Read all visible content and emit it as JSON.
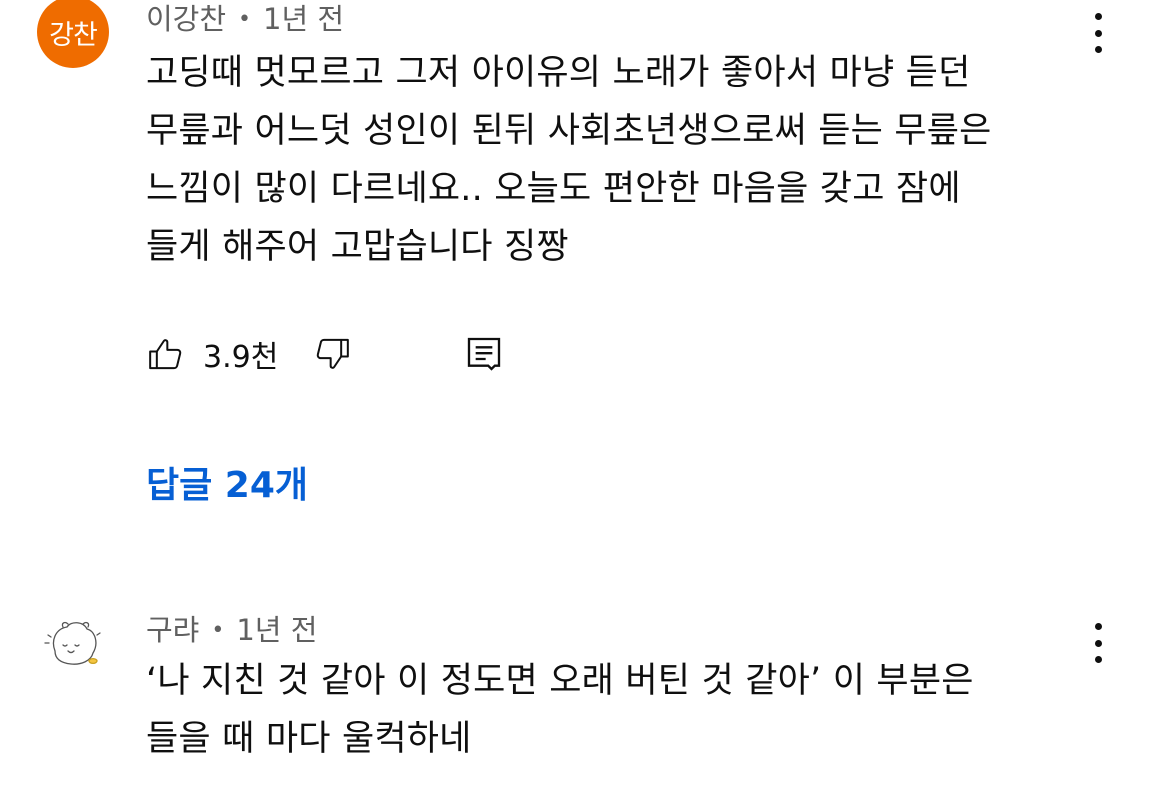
{
  "comments": [
    {
      "avatar_text": "강찬",
      "author": "이강찬",
      "separator": "•",
      "time": "1년 전",
      "lines": [
        "고딩때 멋모르고 그저 아이유의 노래가 좋아서 마냥 듣던",
        "무릎과 어느덧 성인이 된뒤 사회초년생으로써 듣는 무릎은",
        "느낌이 많이 다르네요.. 오늘도 편안한 마음을 갖고 잠에",
        "들게 해주어 고맙습니다 징짱"
      ],
      "likes": "3.9천",
      "replies_label": "답글 24개"
    },
    {
      "author": "구랴",
      "separator": "•",
      "time": "1년 전",
      "lines": [
        "‘나 지친 것 같아 이 정도면 오래 버틴 것 같아’ 이 부분은",
        "들을 때 마다 울컥하네"
      ]
    }
  ],
  "colors": {
    "avatar_orange": "#ef6c00",
    "link_blue": "#065fd4",
    "meta_gray": "#606060"
  },
  "icons": [
    "thumbs-up-icon",
    "thumbs-down-icon",
    "reply-comment-icon",
    "more-vert-icon"
  ]
}
